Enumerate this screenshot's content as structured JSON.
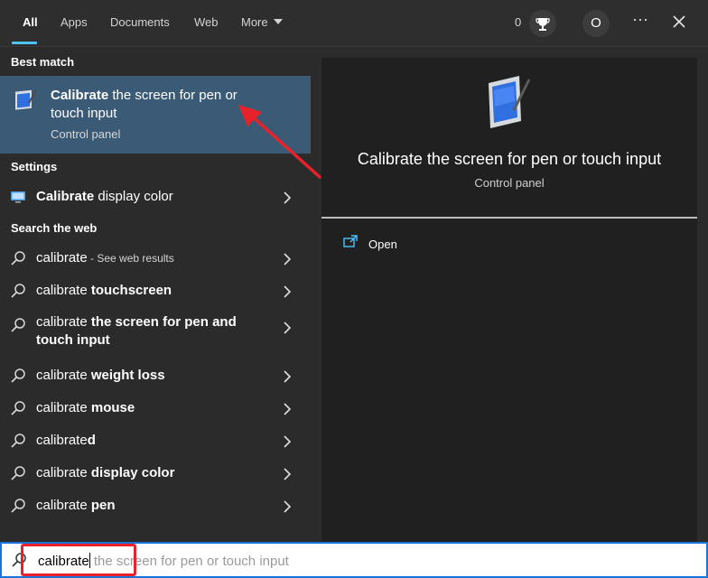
{
  "tabs": [
    {
      "label": "All",
      "active": true
    },
    {
      "label": "Apps"
    },
    {
      "label": "Documents"
    },
    {
      "label": "Web"
    },
    {
      "label": "More"
    }
  ],
  "header": {
    "points": "0",
    "profile_initial": "O",
    "more_options": "⋯",
    "icons": [
      "trophy-icon",
      "ellipsis-icon",
      "close-icon"
    ]
  },
  "best_match": {
    "section": "Best match",
    "title_bold": "Calibrate",
    "title_rest": " the screen for pen or touch input",
    "subtitle": "Control panel",
    "icon": "tablet-pen-icon"
  },
  "settings": {
    "section": "Settings",
    "item": {
      "bold": "Calibrate",
      "rest": " display color",
      "icon": "monitor-icon"
    }
  },
  "web": {
    "section": "Search the web",
    "items": [
      {
        "plain": "calibrate",
        "bold": "",
        "suffix": " - See web results"
      },
      {
        "plain": "calibrate ",
        "bold": "touchscreen"
      },
      {
        "plain": "calibrate ",
        "bold": "the screen for pen and touch input"
      },
      {
        "plain": "calibrate ",
        "bold": "weight loss"
      },
      {
        "plain": "calibrate ",
        "bold": "mouse"
      },
      {
        "plain": "calibrate",
        "bold": "d"
      },
      {
        "plain": "calibrate ",
        "bold": "display color"
      },
      {
        "plain": "calibrate ",
        "bold": "pen"
      }
    ]
  },
  "preview": {
    "title": "Calibrate the screen for pen or touch input",
    "subtitle": "Control panel",
    "actions": [
      {
        "label": "Open",
        "icon": "open-window-icon"
      }
    ]
  },
  "search": {
    "typed": "calibrate",
    "suggestion": " the screen for pen or touch input"
  },
  "colors": {
    "accent": "#4cc2ff",
    "selected_row": "#3a5a75",
    "annotation": "#e8212b"
  }
}
